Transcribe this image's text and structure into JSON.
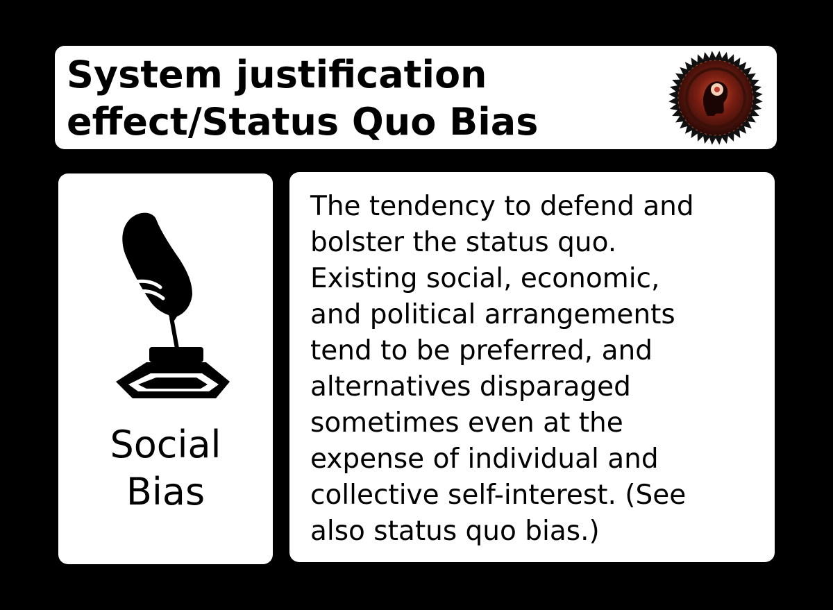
{
  "card": {
    "title": "System justification\neffect/Status Quo Bias",
    "category": "Social\nBias",
    "description": "The tendency to defend and\nbolster the status quo.\nExisting social, economic,\nand political arrangements\ntend to be preferred, and\nalternatives disparaged\nsometimes even at the\nexpense of individual and\ncollective self-interest. (See\nalso status quo bias.)"
  },
  "icons": {
    "category_icon": "quill-inkwell-icon",
    "badge_icon": "cognitive-bias-seal-icon"
  },
  "colors": {
    "background": "#000000",
    "card": "#ffffff",
    "text": "#000000"
  }
}
